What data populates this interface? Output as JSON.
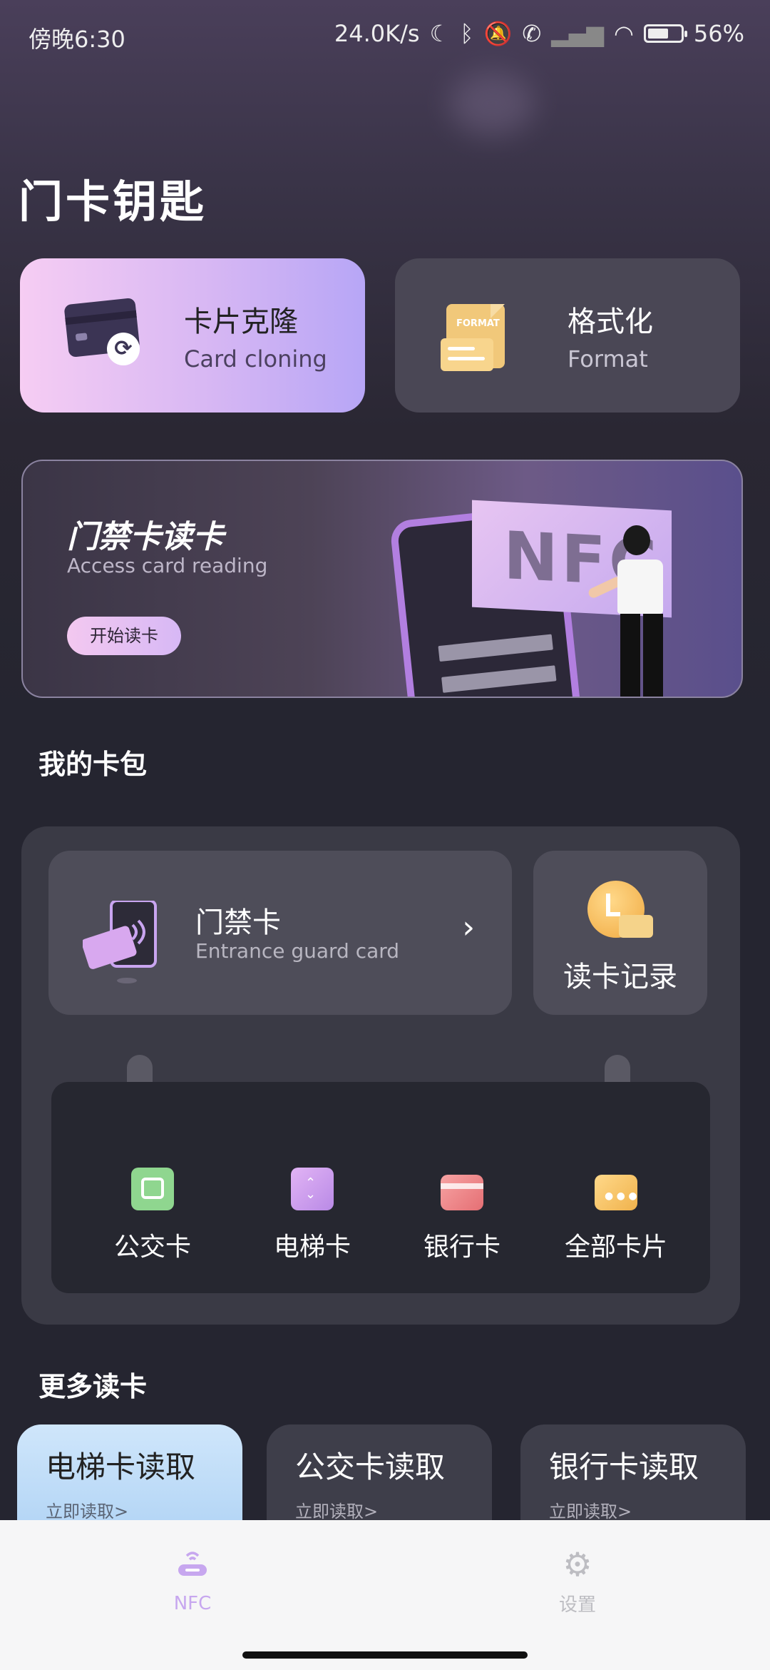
{
  "status_bar": {
    "time": "傍晚6:30",
    "speed": "24.0K/s",
    "battery": "56%"
  },
  "page_title": "门卡钥匙",
  "top_cards": {
    "clone": {
      "cn": "卡片克隆",
      "en": "Card cloning"
    },
    "format": {
      "cn": "格式化",
      "en": "Format",
      "icon_label": "FORMAT"
    }
  },
  "banner": {
    "title": "门禁卡读卡",
    "subtitle": "Access card reading",
    "button": "开始读卡",
    "sign_text": "NFC"
  },
  "wallet": {
    "section_title": "我的卡包",
    "gate": {
      "cn": "门禁卡",
      "en": "Entrance guard card"
    },
    "record": "读卡记录",
    "categories": [
      {
        "label": "公交卡",
        "icon": "bus-card-icon"
      },
      {
        "label": "电梯卡",
        "icon": "elevator-card-icon"
      },
      {
        "label": "银行卡",
        "icon": "bank-card-icon"
      },
      {
        "label": "全部卡片",
        "icon": "all-cards-icon"
      }
    ]
  },
  "more": {
    "section_title": "更多读卡",
    "items": [
      {
        "cn": "电梯卡读取",
        "go": "立即读取>"
      },
      {
        "cn": "公交卡读取",
        "go": "立即读取>"
      },
      {
        "cn": "银行卡读取",
        "go": "立即读取>"
      }
    ]
  },
  "tabbar": {
    "nfc": "NFC",
    "settings": "设置",
    "active_color": "#c7a7ef",
    "inactive_color": "#bdbdc2"
  }
}
